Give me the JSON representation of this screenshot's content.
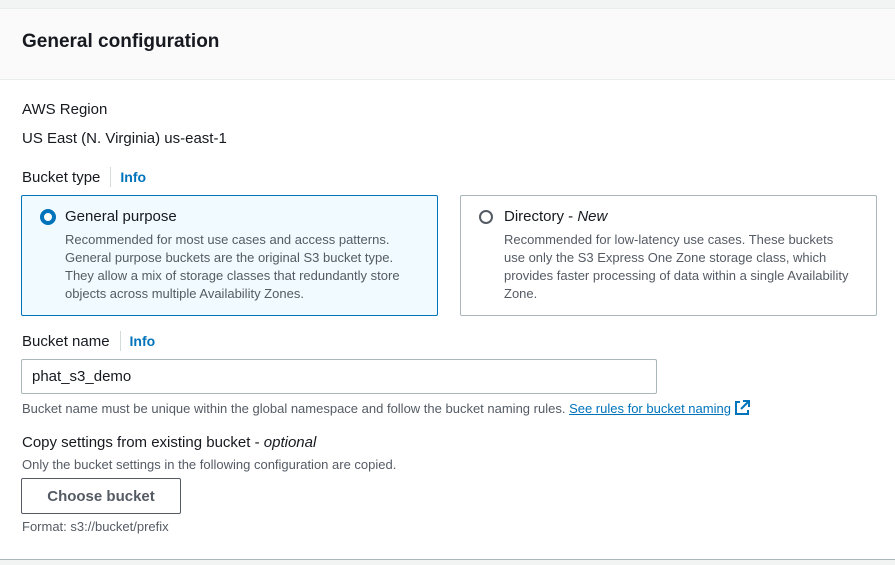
{
  "panel": {
    "title": "General configuration"
  },
  "region": {
    "label": "AWS Region",
    "value": "US East (N. Virginia) us-east-1"
  },
  "bucket_type": {
    "label": "Bucket type",
    "info": "Info",
    "options": [
      {
        "title": "General purpose",
        "title_suffix": "",
        "description": "Recommended for most use cases and access patterns. General purpose buckets are the original S3 bucket type. They allow a mix of storage classes that redundantly store objects across multiple Availability Zones.",
        "selected": true
      },
      {
        "title": "Directory - ",
        "title_suffix": "New",
        "description": "Recommended for low-latency use cases. These buckets use only the S3 Express One Zone storage class, which provides faster processing of data within a single Availability Zone.",
        "selected": false
      }
    ]
  },
  "bucket_name": {
    "label": "Bucket name",
    "info": "Info",
    "value": "phat_s3_demo",
    "hint": "Bucket name must be unique within the global namespace and follow the bucket naming rules.",
    "rules_link": "See rules for bucket naming"
  },
  "copy_settings": {
    "label": "Copy settings from existing bucket - ",
    "label_optional": "optional",
    "description": "Only the bucket settings in the following configuration are copied.",
    "button": "Choose bucket",
    "format_hint": "Format: s3://bucket/prefix"
  },
  "colors": {
    "accent": "#0073bb",
    "selected_bg": "#f1faff",
    "text": "#16191f",
    "muted": "#545b64"
  },
  "icons": {
    "external_link": "external-link-icon"
  }
}
